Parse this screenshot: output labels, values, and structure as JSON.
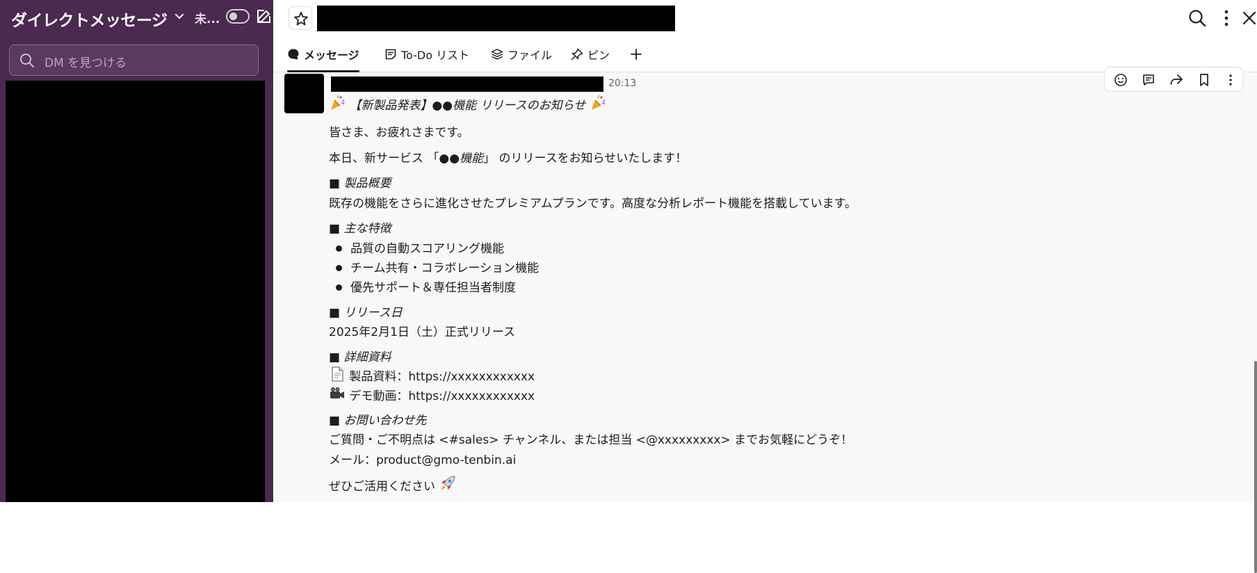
{
  "sidebar": {
    "title": "ダイレクトメッセージ",
    "unread_label": "未...",
    "search_placeholder": "DM を見つける"
  },
  "topbar": {
    "icons": [
      "star-icon",
      "search-icon",
      "kebab-icon",
      "close-icon"
    ]
  },
  "tabs": [
    {
      "label": "メッセージ",
      "icon": "message-icon"
    },
    {
      "label": "To-Do リスト",
      "icon": "todo-icon"
    },
    {
      "label": "ファイル",
      "icon": "files-icon"
    },
    {
      "label": "ピン",
      "icon": "pin-icon"
    }
  ],
  "message": {
    "time": "20:13",
    "headline": "【新製品発表】●●機能 リリースのお知らせ",
    "greeting": "皆さま、お疲れさまです。",
    "intro_a": "本日、新サービス 「●●",
    "intro_b": "機能",
    "intro_c": "」 のリリースをお知らせいたします！",
    "sec1_title": "■ 製品概要",
    "sec1_body": "既存の機能をさらに進化させたプレミアムプランです。高度な分析レポート機能を搭載しています。",
    "sec2_title": "■ 主な特徴",
    "features": [
      "品質の自動スコアリング機能",
      "チーム共有・コラボレーション機能",
      "優先サポート＆専任担当者制度"
    ],
    "sec3_title": "■ リリース日",
    "sec3_body": "2025年2月1日（土）正式リリース",
    "sec4_title": "■ 詳細資料",
    "doc_link": "製品資料：https://xxxxxxxxxxxx",
    "video_link": "デモ動画：https://xxxxxxxxxxxx",
    "sec5_title": "■ お問い合わせ先",
    "contact_line": "ご質問・ご不明点は <#sales> チャンネル、または担当 <@xxxxxxxxx> までお気軽にどうぞ！",
    "mail_line": "メール：product@gmo-tenbin.ai",
    "closing": "ぜひご活用ください"
  }
}
